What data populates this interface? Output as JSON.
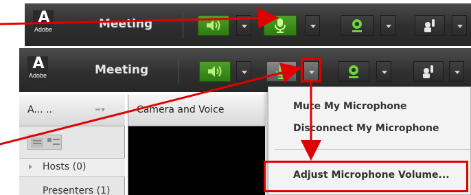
{
  "screenshot_top": {
    "brand": {
      "mark": "A",
      "word": "Adobe"
    },
    "app_title": "Meeting"
  },
  "screenshot_bottom": {
    "brand": {
      "mark": "A",
      "word": "Adobe"
    },
    "app_title": "Meeting",
    "attendee_pod": {
      "title": "A...  ..",
      "menu_glyph": "≡▾",
      "hosts_label": "Hosts (0)",
      "participants_label": "Presenters (1)"
    },
    "camera_pod": {
      "title": "Camera and Voice"
    },
    "mic_menu": {
      "items": [
        "Mute My Microphone",
        "Disconnect My Microphone",
        "Adjust Microphone Volume..."
      ]
    }
  },
  "colors": {
    "toolbar": "#2e2e2e",
    "active_green": "#3c8c1a",
    "icon_green": "#7fe040",
    "annotation_red": "#e00000",
    "menu_bg": "#f3f3f3"
  },
  "icons": [
    "adobe-logo",
    "speaker-icon",
    "microphone-icon",
    "webcam-icon",
    "raise-hand-icon",
    "chevron-down-icon"
  ]
}
